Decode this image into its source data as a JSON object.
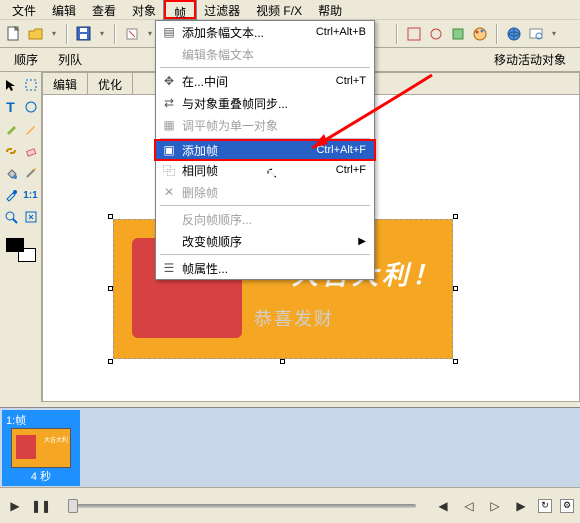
{
  "menubar": [
    "文件",
    "编辑",
    "查看",
    "对象",
    "帧",
    "过滤器",
    "视频 F/X",
    "帮助"
  ],
  "menubar_active_index": 4,
  "toolbar2": {
    "left1": "顺序",
    "left2": "列队",
    "right": "移动活动对象"
  },
  "tabs": [
    "编辑",
    "优化"
  ],
  "dropdown": [
    {
      "type": "item",
      "icon": "banner",
      "label": "添加条幅文本...",
      "shortcut": "Ctrl+Alt+B"
    },
    {
      "type": "item",
      "icon": "",
      "label": "编辑条幅文本",
      "shortcut": "",
      "dim": true
    },
    {
      "type": "sep"
    },
    {
      "type": "item",
      "icon": "center",
      "label": "在...中间",
      "shortcut": "Ctrl+T"
    },
    {
      "type": "item",
      "icon": "sync",
      "label": "与对象重叠帧同步...",
      "shortcut": ""
    },
    {
      "type": "item",
      "icon": "flatten",
      "label": "调平帧为单一对象",
      "shortcut": "",
      "dim": true
    },
    {
      "type": "sep"
    },
    {
      "type": "item",
      "icon": "add",
      "label": "添加帧",
      "shortcut": "Ctrl+Alt+F",
      "hl": true
    },
    {
      "type": "item",
      "icon": "same",
      "label": "相同帧",
      "shortcut": "Ctrl+F"
    },
    {
      "type": "item",
      "icon": "del",
      "label": "删除帧",
      "shortcut": "",
      "dim": true
    },
    {
      "type": "sep"
    },
    {
      "type": "item",
      "icon": "",
      "label": "反向帧顺序...",
      "shortcut": "",
      "dim": true
    },
    {
      "type": "item",
      "icon": "",
      "label": "改变帧顺序",
      "shortcut": "",
      "submenu": true
    },
    {
      "type": "sep"
    },
    {
      "type": "item",
      "icon": "props",
      "label": "帧属性...",
      "shortcut": ""
    }
  ],
  "banner": {
    "bigtext": "大吉大利！",
    "subtext": "恭喜发财"
  },
  "frame": {
    "header": "1:帧",
    "footer": "4 秒",
    "preview_text": "大吉大利"
  },
  "playbar_icons": [
    "play",
    "pause",
    "stop",
    "prev",
    "next",
    "end",
    "loop"
  ]
}
